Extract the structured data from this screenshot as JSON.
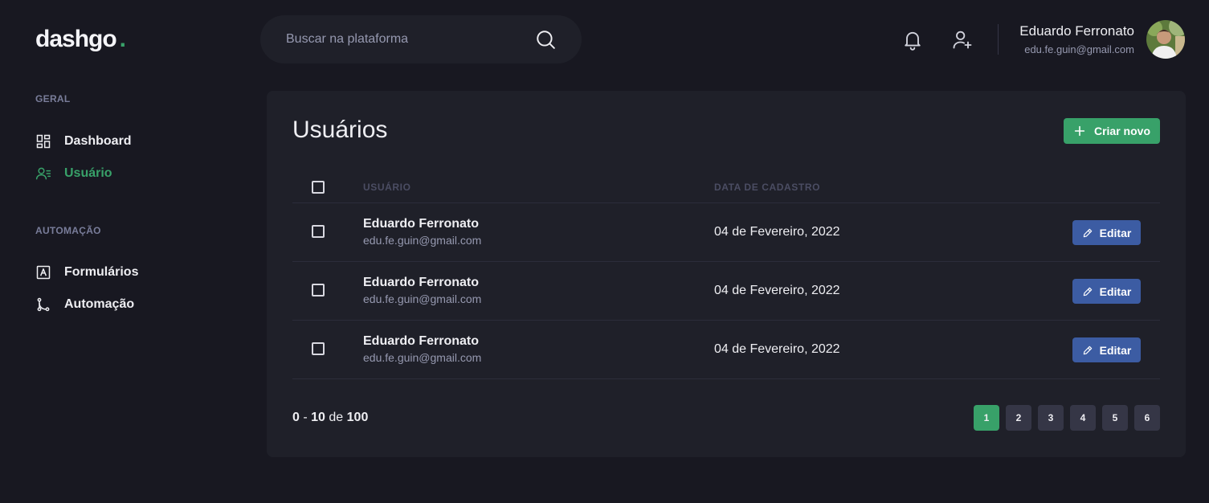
{
  "brand": {
    "name": "dashgo",
    "dot": "."
  },
  "search": {
    "placeholder": "Buscar na plataforma"
  },
  "profile": {
    "name": "Eduardo Ferronato",
    "email": "edu.fe.guin@gmail.com"
  },
  "sidebar": {
    "sections": [
      {
        "title": "GERAL",
        "items": [
          {
            "label": "Dashboard",
            "icon": "dashboard-icon",
            "active": false
          },
          {
            "label": "Usuário",
            "icon": "users-icon",
            "active": true
          }
        ]
      },
      {
        "title": "AUTOMAÇÃO",
        "items": [
          {
            "label": "Formulários",
            "icon": "forms-icon",
            "active": false
          },
          {
            "label": "Automação",
            "icon": "git-merge-icon",
            "active": false
          }
        ]
      }
    ]
  },
  "main": {
    "title": "Usuários",
    "new_button": "Criar novo",
    "table": {
      "columns": [
        "USUÁRIO",
        "DATA DE CADASTRO"
      ],
      "rows": [
        {
          "name": "Eduardo Ferronato",
          "email": "edu.fe.guin@gmail.com",
          "date": "04 de Fevereiro, 2022",
          "action": "Editar"
        },
        {
          "name": "Eduardo Ferronato",
          "email": "edu.fe.guin@gmail.com",
          "date": "04 de Fevereiro, 2022",
          "action": "Editar"
        },
        {
          "name": "Eduardo Ferronato",
          "email": "edu.fe.guin@gmail.com",
          "date": "04 de Fevereiro, 2022",
          "action": "Editar"
        }
      ]
    },
    "pagination": {
      "from": "0",
      "to": "10",
      "sep": "-",
      "of": "de",
      "total": "100",
      "pages": [
        "1",
        "2",
        "3",
        "4",
        "5",
        "6"
      ],
      "current": "1"
    }
  },
  "colors": {
    "accent": "#38a169",
    "edit": "#3c5ca3",
    "background": "#181821",
    "panel": "#1f2029"
  }
}
